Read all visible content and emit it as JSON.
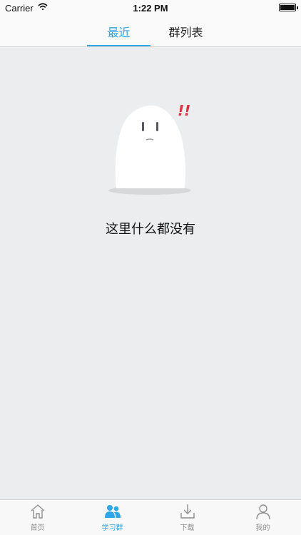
{
  "status_bar": {
    "carrier": "Carrier",
    "time": "1:22 PM"
  },
  "segments": {
    "recent": "最近",
    "group_list": "群列表",
    "active_color": "#2ea7e9"
  },
  "empty_state": {
    "message": "这里什么都没有",
    "illustration_mark": "!!"
  },
  "tabbar": {
    "items": [
      {
        "label": "首页",
        "icon": "home-icon"
      },
      {
        "label": "学习群",
        "icon": "people-icon",
        "active": true
      },
      {
        "label": "下载",
        "icon": "download-icon"
      },
      {
        "label": "我的",
        "icon": "person-icon"
      }
    ]
  }
}
